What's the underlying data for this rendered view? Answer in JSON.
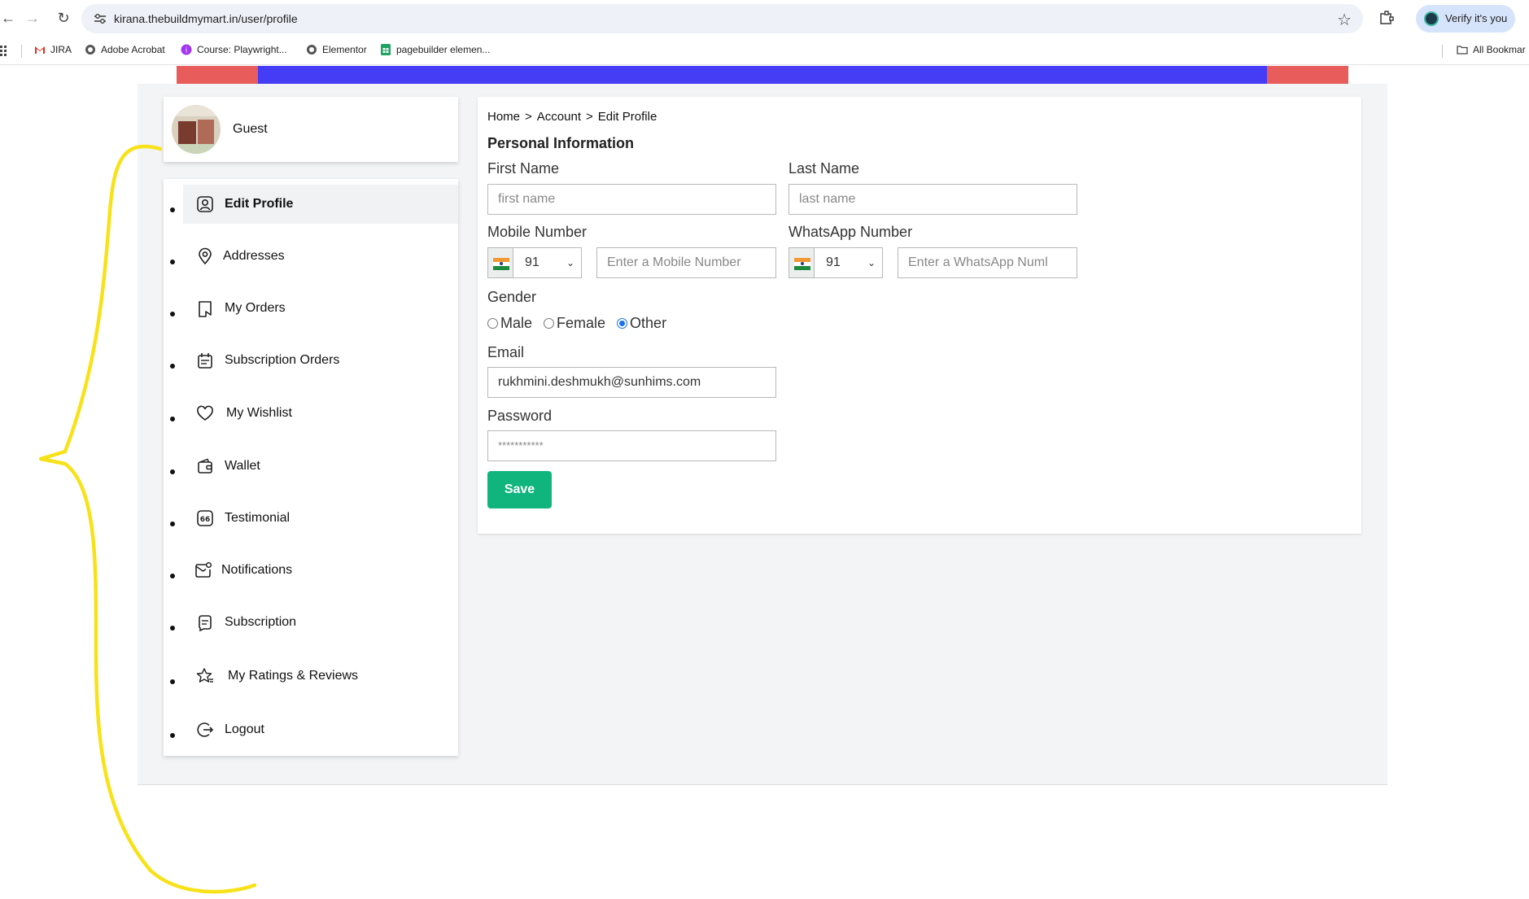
{
  "browser": {
    "url": "kirana.thebuildmymart.in/user/profile",
    "profile_label": "Verify it's you",
    "bookmarks": [
      "JIRA",
      "Adobe Acrobat",
      "Course: Playwright...",
      "Elementor",
      "pagebuilder elemen..."
    ],
    "all_bookmarks_label": "All Bookmar"
  },
  "colors": {
    "strip_red": "#e85c5c",
    "strip_blue": "#453cf5",
    "save_green": "#0fb57c",
    "annotation_yellow": "#f7e21a"
  },
  "user": {
    "name": "Guest"
  },
  "sidebar": {
    "items": [
      {
        "label": "Edit Profile",
        "icon": "user-profile-icon",
        "active": true
      },
      {
        "label": "Addresses",
        "icon": "location-pin-icon"
      },
      {
        "label": "My Orders",
        "icon": "orders-icon"
      },
      {
        "label": "Subscription Orders",
        "icon": "calendar-icon"
      },
      {
        "label": "My Wishlist",
        "icon": "heart-icon"
      },
      {
        "label": "Wallet",
        "icon": "wallet-icon"
      },
      {
        "label": "Testimonial",
        "icon": "quote-icon"
      },
      {
        "label": "Notifications",
        "icon": "mail-notification-icon"
      },
      {
        "label": "Subscription",
        "icon": "subscription-icon"
      },
      {
        "label": "My Ratings & Reviews",
        "icon": "star-rating-icon"
      },
      {
        "label": "Logout",
        "icon": "logout-icon"
      }
    ]
  },
  "breadcrumb": {
    "home": "Home",
    "sep": ">",
    "account": "Account",
    "current": "Edit Profile"
  },
  "form": {
    "section_title": "Personal Information",
    "first_name": {
      "label": "First Name",
      "placeholder": "first name"
    },
    "last_name": {
      "label": "Last Name",
      "placeholder": "last name"
    },
    "mobile": {
      "label": "Mobile Number",
      "code": "91",
      "placeholder": "Enter a Mobile Number"
    },
    "whatsapp": {
      "label": "WhatsApp Number",
      "code": "91",
      "placeholder": "Enter a WhatsApp Numl"
    },
    "gender": {
      "label": "Gender",
      "options": [
        "Male",
        "Female",
        "Other"
      ],
      "selected": "Other"
    },
    "email": {
      "label": "Email",
      "value": "rukhmini.deshmukh@sunhims.com"
    },
    "password": {
      "label": "Password",
      "value": "***********"
    },
    "save_label": "Save"
  }
}
